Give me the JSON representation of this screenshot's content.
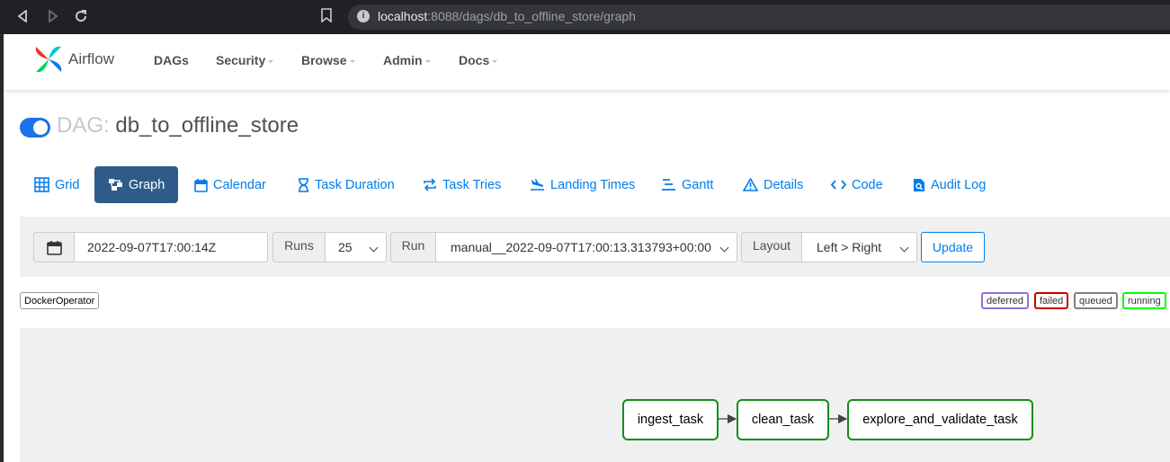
{
  "browser": {
    "url_host": "localhost",
    "url_path": ":8088/dags/db_to_offline_store/graph"
  },
  "navbar": {
    "brand": "Airflow",
    "menu": [
      {
        "label": "DAGs",
        "dropdown": false
      },
      {
        "label": "Security",
        "dropdown": true
      },
      {
        "label": "Browse",
        "dropdown": true
      },
      {
        "label": "Admin",
        "dropdown": true
      },
      {
        "label": "Docs",
        "dropdown": true
      }
    ]
  },
  "dag": {
    "prefix": "DAG:",
    "id": "db_to_offline_store",
    "paused": false
  },
  "tabs": [
    {
      "label": "Grid",
      "icon": "grid-icon",
      "active": false
    },
    {
      "label": "Graph",
      "icon": "graph-icon",
      "active": true
    },
    {
      "label": "Calendar",
      "icon": "calendar-icon",
      "active": false
    },
    {
      "label": "Task Duration",
      "icon": "hourglass-icon",
      "active": false
    },
    {
      "label": "Task Tries",
      "icon": "repeat-icon",
      "active": false
    },
    {
      "label": "Landing Times",
      "icon": "plane-landing-icon",
      "active": false
    },
    {
      "label": "Gantt",
      "icon": "gantt-icon",
      "active": false
    },
    {
      "label": "Details",
      "icon": "warning-icon",
      "active": false
    },
    {
      "label": "Code",
      "icon": "code-icon",
      "active": false
    },
    {
      "label": "Audit Log",
      "icon": "audit-log-icon",
      "active": false
    }
  ],
  "filters": {
    "date_value": "2022-09-07T17:00:14Z",
    "runs_label": "Runs",
    "runs_value": "25",
    "run_label": "Run",
    "run_value": "manual__2022-09-07T17:00:13.313793+00:00",
    "layout_label": "Layout",
    "layout_value": "Left > Right",
    "update_label": "Update"
  },
  "operator_legend": [
    "DockerOperator"
  ],
  "state_legend": [
    {
      "label": "deferred",
      "color": "#9370db"
    },
    {
      "label": "failed",
      "color": "#cc0000"
    },
    {
      "label": "queued",
      "color": "#808080"
    },
    {
      "label": "running",
      "color": "#00ff00"
    }
  ],
  "graph": {
    "nodes": [
      {
        "label": "ingest_task",
        "state_color": "#118d1c"
      },
      {
        "label": "clean_task",
        "state_color": "#118d1c"
      },
      {
        "label": "explore_and_validate_task",
        "state_color": "#118d1c"
      }
    ]
  }
}
